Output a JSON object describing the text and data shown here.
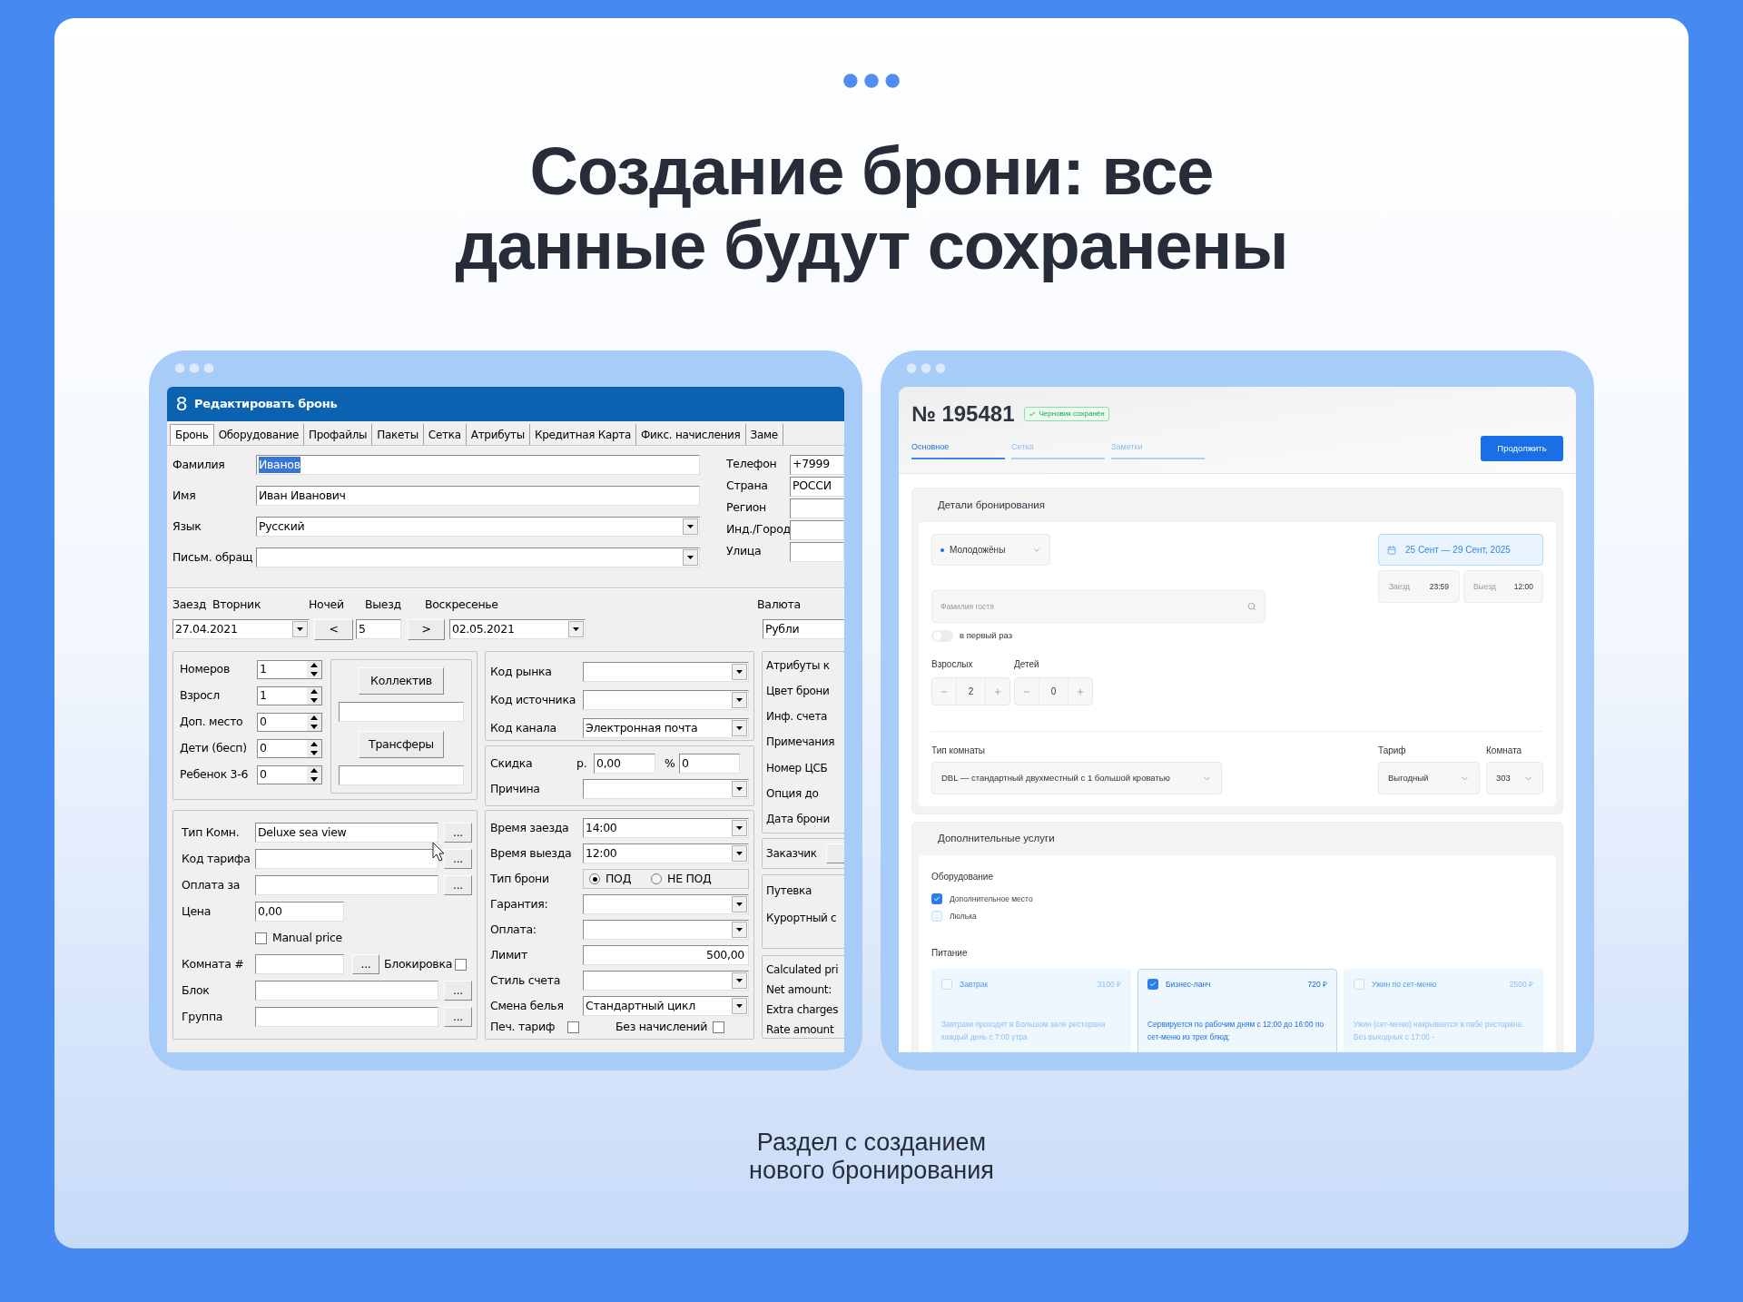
{
  "heading_lines": [
    "Создание брони: все",
    "данные будут сохранены"
  ],
  "legacy": {
    "logo": "8",
    "title": "Редактировать бронь",
    "tabs": [
      {
        "label": "Бронь",
        "selected": true
      },
      {
        "label": "Оборудование",
        "selected": false
      },
      {
        "label": "Профайлы",
        "selected": false
      },
      {
        "label": "Пакеты",
        "selected": false
      },
      {
        "label": "Сетка",
        "selected": false
      },
      {
        "label": "Атрибуты",
        "selected": false
      },
      {
        "label": "Кредитная Карта",
        "selected": false
      },
      {
        "label": "Фикс. начисления",
        "selected": false
      },
      {
        "label": "Заме",
        "selected": false
      }
    ],
    "guest_fields": [
      {
        "label": "Фамилия",
        "value": "Иванов",
        "kind": "text",
        "text_selected": true
      },
      {
        "label": "Имя",
        "value": "Иван Иванович",
        "kind": "text",
        "text_selected": false
      },
      {
        "label": "Язык",
        "value": "Русский",
        "kind": "select"
      },
      {
        "label": "Письм. обращ",
        "kind": "select"
      }
    ],
    "contact_fields": [
      {
        "label": "Телефон",
        "value": "+7999"
      },
      {
        "label": "Страна",
        "value": "РОССИ"
      },
      {
        "label": "Регион"
      },
      {
        "label": "Инд./Город"
      },
      {
        "label": "Улица"
      }
    ],
    "stay": {
      "checkin_label": "Заезд",
      "checkin_day": "Вторник",
      "nights_label": "Ночей",
      "checkout_label": "Выезд",
      "checkout_day": "Воскресенье",
      "checkin": "27.04.2021",
      "prev": "<",
      "nights": "5",
      "next": ">",
      "checkout": "02.05.2021",
      "currency_label": "Валюта",
      "currency": "Рубли"
    },
    "counters": [
      {
        "label": "Номеров",
        "value": "1"
      },
      {
        "label": "Взросл",
        "value": "1"
      },
      {
        "label": "Доп. место",
        "value": "0"
      },
      {
        "label": "Дети (бесп)",
        "value": "0"
      },
      {
        "label": "Ребенок 3-6",
        "value": "0"
      }
    ],
    "group_buttons": [
      "Коллектив",
      "Трансферы"
    ],
    "market_fields": [
      {
        "label": "Код рынка"
      },
      {
        "label": "Код источника"
      },
      {
        "label": "Код канала",
        "value": "Электронная почта"
      }
    ],
    "discount": {
      "label": "Скидка",
      "currency": "р.",
      "amount": "0,00",
      "percent_sign": "%",
      "percent": "0",
      "reason_label": "Причина"
    },
    "room_fields": [
      {
        "label": "Тип Комн.",
        "value": "Deluxe sea view",
        "kind": "lookup",
        "button": "..."
      },
      {
        "label": "Код тарифа",
        "kind": "lookup",
        "button": "..."
      },
      {
        "label": "Оплата за",
        "kind": "lookup",
        "button": "..."
      },
      {
        "label": "Цена",
        "value": "0,00",
        "kind": "short"
      }
    ],
    "manual_price": {
      "label": "Manual price",
      "checked": false
    },
    "room_number": {
      "label": "Комната #",
      "button": "...",
      "block_label": "Блокировка",
      "blocked": false
    },
    "lower_fields": [
      {
        "label": "Блок",
        "button": "..."
      },
      {
        "label": "Группа",
        "button": "..."
      }
    ],
    "booking_fields": [
      {
        "label": "Время заезда",
        "value": "14:00",
        "kind": "select"
      },
      {
        "label": "Время выезда",
        "value": "12:00",
        "kind": "select"
      },
      {
        "label": "Тип брони",
        "kind": "radio",
        "options": [
          {
            "label": "ПОД",
            "selected": true
          },
          {
            "label": "НЕ ПОД",
            "selected": false
          }
        ]
      },
      {
        "label": "Гарантия:",
        "kind": "select"
      },
      {
        "label": "Оплата:",
        "kind": "select"
      },
      {
        "label": "Лимит",
        "value": "500,00",
        "kind": "number"
      },
      {
        "label": "Стиль счета",
        "kind": "select"
      },
      {
        "label": "Смена белья",
        "value": "Стандартный цикл",
        "kind": "select"
      }
    ],
    "print_rate": {
      "label": "Печ. тариф",
      "checked": false
    },
    "no_charges": {
      "label": "Без начислений",
      "checked": false
    },
    "side_groups": [
      [
        "Атрибуты к",
        "Цвет брони",
        "Инф. счета",
        "Примечания",
        "Номер ЦСБ",
        "Опция до",
        "Дата брони"
      ],
      [
        "Заказчик"
      ],
      [
        "Путевка",
        "Курортный с"
      ],
      [
        "Calculated pri",
        "Net amount:",
        "Extra charges",
        "Rate amount"
      ]
    ]
  },
  "app": {
    "number": "№ 195481",
    "badge": "Черновик сохранён",
    "tabs": [
      {
        "label": "Основное",
        "selected": true
      },
      {
        "label": "Сетка",
        "selected": false
      },
      {
        "label": "Заметки",
        "selected": false
      }
    ],
    "continue_button": "Продолжить",
    "details": {
      "title": "Детали бронирования",
      "segment": "Молодожёны",
      "dates": "25 Сент — 29 Сент, 2025",
      "checkin_label": "Заезд",
      "checkin_time": "23:59",
      "checkout_label": "Выезд",
      "checkout_time": "12:00",
      "guest_placeholder": "Фамилия гостя",
      "first_time": {
        "label": "в первый раз",
        "on": false
      },
      "counters": [
        {
          "label": "Взрослых",
          "value": "2"
        },
        {
          "label": "Детей",
          "value": "0"
        }
      ],
      "room_type_label": "Тип комнаты",
      "room_type": "DBL — стандартный двухместный с 1 большой кроватью",
      "tariff_label": "Тариф",
      "tariff": "Выгодный",
      "room_label": "Комната",
      "room": "303"
    },
    "extras": {
      "title": "Дополнительные услуги",
      "equipment_label": "Оборудование",
      "equipment": [
        {
          "label": "Дополнительное место",
          "checked": true
        },
        {
          "label": "Люлька",
          "checked": false
        }
      ],
      "meals_label": "Питание",
      "meals": [
        {
          "name": "Завтрак",
          "price": "3100 ₽",
          "checked": false,
          "description": "Завтраки проходят в Большом зале ресторана каждый день с 7:00 утра"
        },
        {
          "name": "Бизнес-ланч",
          "price": "720 ₽",
          "checked": true,
          "description": "Сервируется по рабочим дням с 12:00 до 16:00 по сет-меню из трех блюд:"
        },
        {
          "name": "Ужин по сет-меню",
          "price": "2500 ₽",
          "checked": false,
          "description": "Ужин (сет-меню) накрывается в пабе ресторана. Без выходных с 17:00 -"
        }
      ]
    }
  },
  "caption_lines": [
    "Раздел с созданием",
    "нового бронирования"
  ]
}
